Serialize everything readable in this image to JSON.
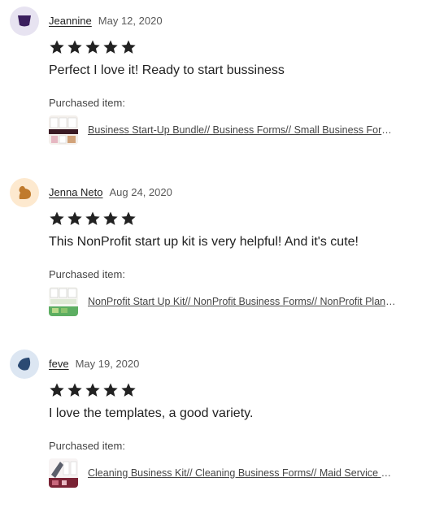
{
  "reviews": [
    {
      "author": "Jeannine",
      "date": "May 12, 2020",
      "rating": 5,
      "text": "Perfect I love it! Ready to start bussiness",
      "purchased_label": "Purchased item:",
      "item_title": "Business Start-Up Bundle// Business Forms// Small Business Forms// Small Business Planner// Business Kit",
      "avatar_color": "#e7e3f1",
      "avatar_shape_color": "#3b1f5e"
    },
    {
      "author": "Jenna Neto",
      "date": "Aug 24, 2020",
      "rating": 5,
      "text": "This NonProfit start up kit is very helpful! And it's cute!",
      "purchased_label": "Purchased item:",
      "item_title": "NonProfit Start Up Kit// NonProfit Business Forms// NonProfit Planner",
      "avatar_color": "#fde9cf",
      "avatar_shape_color": "#c07a2c"
    },
    {
      "author": "feve",
      "date": "May 19, 2020",
      "rating": 5,
      "text": "I love the templates, a good variety.",
      "purchased_label": "Purchased item:",
      "item_title": "Cleaning Business Kit// Cleaning Business Forms// Maid Service Forms",
      "avatar_color": "#dce6f2",
      "avatar_shape_color": "#2b4a73"
    }
  ],
  "icons": {
    "star": "star-icon"
  },
  "colors": {
    "star": "#222222"
  }
}
